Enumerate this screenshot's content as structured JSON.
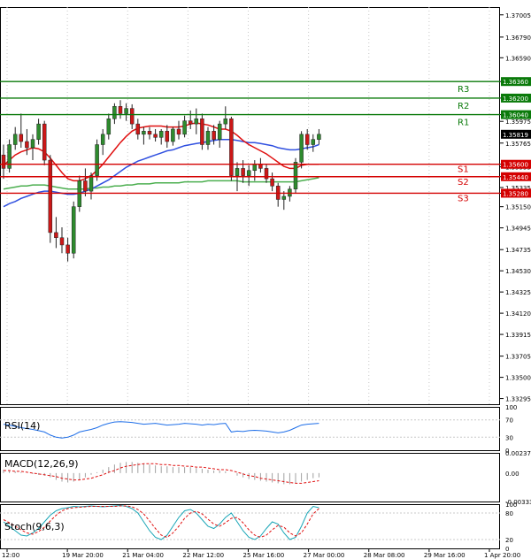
{
  "chart_data": {
    "type": "candlestick",
    "instrument_price": "1.35819",
    "main_panel": {
      "price_ticks": [
        "1.37005",
        "1.36790",
        "1.36590",
        "1.36360",
        "1.36200",
        "1.36040",
        "1.35975",
        "1.35765",
        "1.35560",
        "1.35535",
        "1.35440",
        "1.35335",
        "1.35280",
        "1.35150",
        "1.34945",
        "1.34735",
        "1.34530",
        "1.34325",
        "1.34120",
        "1.33915",
        "1.33705",
        "1.33500",
        "1.33295"
      ],
      "ylim": [
        1.3324,
        1.3708
      ],
      "levels": [
        {
          "name": "R3",
          "value": 1.3636,
          "label": "1.36360",
          "kind": "resistance"
        },
        {
          "name": "R2",
          "value": 1.362,
          "label": "1.36200",
          "kind": "resistance"
        },
        {
          "name": "R1",
          "value": 1.3604,
          "label": "1.36040",
          "kind": "resistance"
        },
        {
          "name": "S1",
          "value": 1.3556,
          "label": "1.35600",
          "kind": "support"
        },
        {
          "name": "S2",
          "value": 1.3544,
          "label": "1.35440",
          "kind": "support"
        },
        {
          "name": "S3",
          "value": 1.3528,
          "label": "1.35280",
          "kind": "support"
        }
      ],
      "x_ticks": [
        "12:00",
        "19 Mar 20:00",
        "21 Mar 04:00",
        "22 Mar 12:00",
        "25 Mar 16:00",
        "27 Mar 00:00",
        "28 Mar 08:00",
        "29 Mar 16:00",
        "1 Apr 20:00"
      ],
      "candles": [
        [
          1.3565,
          1.3575,
          1.3542,
          1.3552
        ],
        [
          1.3552,
          1.358,
          1.3548,
          1.3575
        ],
        [
          1.3575,
          1.3592,
          1.357,
          1.3585
        ],
        [
          1.3585,
          1.3605,
          1.3572,
          1.3578
        ],
        [
          1.3578,
          1.359,
          1.3565,
          1.3572
        ],
        [
          1.3572,
          1.3585,
          1.356,
          1.358
        ],
        [
          1.358,
          1.36,
          1.3575,
          1.3595
        ],
        [
          1.3595,
          1.3598,
          1.3555,
          1.356
        ],
        [
          1.356,
          1.3565,
          1.348,
          1.349
        ],
        [
          1.349,
          1.3505,
          1.3475,
          1.3485
        ],
        [
          1.3485,
          1.3495,
          1.347,
          1.3478
        ],
        [
          1.3478,
          1.3485,
          1.3462,
          1.347
        ],
        [
          1.347,
          1.352,
          1.3465,
          1.3515
        ],
        [
          1.3515,
          1.3545,
          1.351,
          1.354
        ],
        [
          1.354,
          1.3552,
          1.3525,
          1.353
        ],
        [
          1.353,
          1.3548,
          1.3522,
          1.3545
        ],
        [
          1.3545,
          1.358,
          1.354,
          1.3575
        ],
        [
          1.3575,
          1.359,
          1.3565,
          1.3585
        ],
        [
          1.3585,
          1.3605,
          1.358,
          1.36
        ],
        [
          1.36,
          1.3615,
          1.3595,
          1.3612
        ],
        [
          1.3612,
          1.3618,
          1.36,
          1.3605
        ],
        [
          1.3605,
          1.3615,
          1.3598,
          1.361
        ],
        [
          1.361,
          1.3614,
          1.359,
          1.3595
        ],
        [
          1.3595,
          1.36,
          1.358,
          1.3585
        ],
        [
          1.3585,
          1.3592,
          1.3575,
          1.3588
        ],
        [
          1.3588,
          1.3592,
          1.358,
          1.3585
        ],
        [
          1.3585,
          1.359,
          1.3578,
          1.3582
        ],
        [
          1.3582,
          1.359,
          1.3575,
          1.3588
        ],
        [
          1.3588,
          1.3594,
          1.3572,
          1.3578
        ],
        [
          1.3578,
          1.3592,
          1.3574,
          1.359
        ],
        [
          1.359,
          1.3598,
          1.358,
          1.3585
        ],
        [
          1.3585,
          1.3603,
          1.3582,
          1.3598
        ],
        [
          1.3598,
          1.3608,
          1.359,
          1.3595
        ],
        [
          1.3595,
          1.361,
          1.3585,
          1.36
        ],
        [
          1.36,
          1.3605,
          1.357,
          1.3575
        ],
        [
          1.3575,
          1.3592,
          1.357,
          1.3588
        ],
        [
          1.3588,
          1.3594,
          1.3575,
          1.358
        ],
        [
          1.358,
          1.3598,
          1.3572,
          1.3595
        ],
        [
          1.3595,
          1.3612,
          1.359,
          1.36
        ],
        [
          1.36,
          1.3602,
          1.354,
          1.3545
        ],
        [
          1.3545,
          1.3558,
          1.353,
          1.3552
        ],
        [
          1.3552,
          1.356,
          1.3538,
          1.3545
        ],
        [
          1.3545,
          1.3555,
          1.3535,
          1.355
        ],
        [
          1.355,
          1.356,
          1.354,
          1.3556
        ],
        [
          1.3556,
          1.3562,
          1.3548,
          1.3552
        ],
        [
          1.3552,
          1.3556,
          1.3538,
          1.3542
        ],
        [
          1.3542,
          1.3548,
          1.353,
          1.3535
        ],
        [
          1.3535,
          1.3538,
          1.3515,
          1.3522
        ],
        [
          1.3522,
          1.353,
          1.3512,
          1.3525
        ],
        [
          1.3525,
          1.3535,
          1.352,
          1.3532
        ],
        [
          1.3532,
          1.3562,
          1.3528,
          1.3558
        ],
        [
          1.3558,
          1.3588,
          1.3552,
          1.3585
        ],
        [
          1.3585,
          1.359,
          1.357,
          1.3575
        ],
        [
          1.3575,
          1.3585,
          1.3568,
          1.358
        ],
        [
          1.358,
          1.359,
          1.3575,
          1.3585
        ]
      ],
      "ma_red": [
        1.3555,
        1.356,
        1.3565,
        1.3568,
        1.357,
        1.3572,
        1.3571,
        1.3568,
        1.3562,
        1.3555,
        1.3548,
        1.3542,
        1.354,
        1.354,
        1.3542,
        1.3545,
        1.355,
        1.3556,
        1.3563,
        1.357,
        1.3577,
        1.3583,
        1.3588,
        1.3591,
        1.3592,
        1.3593,
        1.3593,
        1.3593,
        1.3592,
        1.3592,
        1.3592,
        1.3593,
        1.3595,
        1.3596,
        1.3595,
        1.3594,
        1.3592,
        1.359,
        1.359,
        1.3588,
        1.3584,
        1.3579,
        1.3575,
        1.3572,
        1.3569,
        1.3566,
        1.3562,
        1.3558,
        1.3554,
        1.3552,
        1.3552,
        1.3555,
        1.3556,
        1.3556,
        1.3556
      ],
      "ma_blue": [
        1.3515,
        1.3518,
        1.352,
        1.3523,
        1.3525,
        1.3527,
        1.3529,
        1.353,
        1.353,
        1.3529,
        1.3528,
        1.3527,
        1.3527,
        1.3528,
        1.353,
        1.3532,
        1.3535,
        1.3538,
        1.3541,
        1.3545,
        1.3549,
        1.3553,
        1.3556,
        1.3559,
        1.3561,
        1.3563,
        1.3565,
        1.3567,
        1.3569,
        1.357,
        1.3572,
        1.3574,
        1.3575,
        1.3576,
        1.3577,
        1.3578,
        1.3579,
        1.358,
        1.358,
        1.358,
        1.3579,
        1.3578,
        1.3577,
        1.3577,
        1.3576,
        1.3575,
        1.3574,
        1.3572,
        1.3571,
        1.357,
        1.357,
        1.3571,
        1.3572,
        1.3573,
        1.3575
      ],
      "ma_green": [
        1.3532,
        1.3533,
        1.3534,
        1.3535,
        1.3535,
        1.3536,
        1.3536,
        1.3536,
        1.3535,
        1.3534,
        1.3533,
        1.3532,
        1.3532,
        1.3532,
        1.3532,
        1.3533,
        1.3533,
        1.3534,
        1.3534,
        1.3535,
        1.3535,
        1.3536,
        1.3536,
        1.3537,
        1.3537,
        1.3537,
        1.3538,
        1.3538,
        1.3538,
        1.3538,
        1.3538,
        1.3539,
        1.3539,
        1.3539,
        1.3539,
        1.354,
        1.354,
        1.354,
        1.354,
        1.354,
        1.354,
        1.3539,
        1.3539,
        1.3539,
        1.3539,
        1.3539,
        1.3539,
        1.3539,
        1.3539,
        1.3539,
        1.3539,
        1.354,
        1.3541,
        1.3542,
        1.3543
      ]
    },
    "rsi_panel": {
      "label": "RSI(14)",
      "ticks": [
        "100",
        "70",
        "30",
        "0"
      ],
      "ylim": [
        0,
        100
      ],
      "values": [
        60,
        58,
        55,
        52,
        50,
        48,
        45,
        42,
        35,
        30,
        28,
        30,
        35,
        42,
        45,
        48,
        52,
        58,
        62,
        65,
        66,
        65,
        64,
        62,
        60,
        61,
        62,
        60,
        58,
        59,
        60,
        62,
        61,
        60,
        58,
        60,
        59,
        61,
        62,
        42,
        44,
        43,
        45,
        46,
        45,
        44,
        42,
        40,
        42,
        46,
        52,
        58,
        60,
        61,
        62
      ]
    },
    "macd_panel": {
      "label": "MACD(12,26,9)",
      "ticks": [
        "0.00237",
        "0.00",
        "-0.003331"
      ],
      "ylim": [
        -0.003331,
        0.00237
      ],
      "histogram": [
        0.0004,
        0.0003,
        0.0002,
        0.0001,
        0.0,
        -0.0001,
        -0.0002,
        -0.0003,
        -0.0005,
        -0.0008,
        -0.001,
        -0.0011,
        -0.001,
        -0.0008,
        -0.0005,
        -0.0002,
        0.0001,
        0.0004,
        0.0007,
        0.001,
        0.0012,
        0.0013,
        0.0013,
        0.0012,
        0.0011,
        0.001,
        0.0009,
        0.0008,
        0.0008,
        0.0007,
        0.0007,
        0.0007,
        0.0007,
        0.0006,
        0.0005,
        0.0004,
        0.0003,
        0.0003,
        0.0002,
        0.0,
        -0.0003,
        -0.0005,
        -0.0007,
        -0.0008,
        -0.0009,
        -0.001,
        -0.0011,
        -0.0012,
        -0.0013,
        -0.0013,
        -0.0012,
        -0.001,
        -0.0008,
        -0.0006,
        -0.0005
      ],
      "signal": [
        0.0003,
        0.0003,
        0.0002,
        0.0002,
        0.0001,
        0.0,
        -0.0001,
        -0.0002,
        -0.0003,
        -0.0004,
        -0.0006,
        -0.0007,
        -0.0008,
        -0.0008,
        -0.0007,
        -0.0006,
        -0.0004,
        -0.0002,
        0.0001,
        0.0003,
        0.0006,
        0.0008,
        0.0009,
        0.001,
        0.0011,
        0.0011,
        0.0011,
        0.001,
        0.001,
        0.0009,
        0.0009,
        0.0008,
        0.0008,
        0.0007,
        0.0007,
        0.0006,
        0.0005,
        0.0004,
        0.0004,
        0.0003,
        0.0001,
        -0.0001,
        -0.0003,
        -0.0004,
        -0.0006,
        -0.0007,
        -0.0008,
        -0.0009,
        -0.001,
        -0.0011,
        -0.0012,
        -0.0012,
        -0.0011,
        -0.001,
        -0.0009
      ]
    },
    "stoch_panel": {
      "label": "Stoch(9,6,3)",
      "ticks": [
        "100",
        "80",
        "20",
        "0"
      ],
      "ylim": [
        0,
        100
      ],
      "k": [
        60,
        50,
        40,
        30,
        28,
        35,
        45,
        60,
        75,
        85,
        90,
        92,
        95,
        94,
        95,
        96,
        95,
        94,
        95,
        96,
        97,
        95,
        90,
        80,
        60,
        40,
        25,
        20,
        30,
        50,
        70,
        85,
        88,
        80,
        65,
        50,
        45,
        55,
        70,
        80,
        60,
        40,
        25,
        20,
        28,
        45,
        60,
        55,
        35,
        20,
        25,
        50,
        80,
        95,
        92
      ],
      "d": [
        65,
        58,
        50,
        42,
        35,
        32,
        38,
        48,
        62,
        75,
        85,
        90,
        92,
        93,
        94,
        95,
        95,
        95,
        95,
        95,
        96,
        96,
        94,
        88,
        78,
        62,
        45,
        30,
        25,
        35,
        50,
        68,
        80,
        84,
        78,
        66,
        55,
        50,
        58,
        68,
        70,
        58,
        42,
        30,
        25,
        30,
        42,
        52,
        48,
        35,
        28,
        35,
        55,
        78,
        90
      ]
    }
  }
}
